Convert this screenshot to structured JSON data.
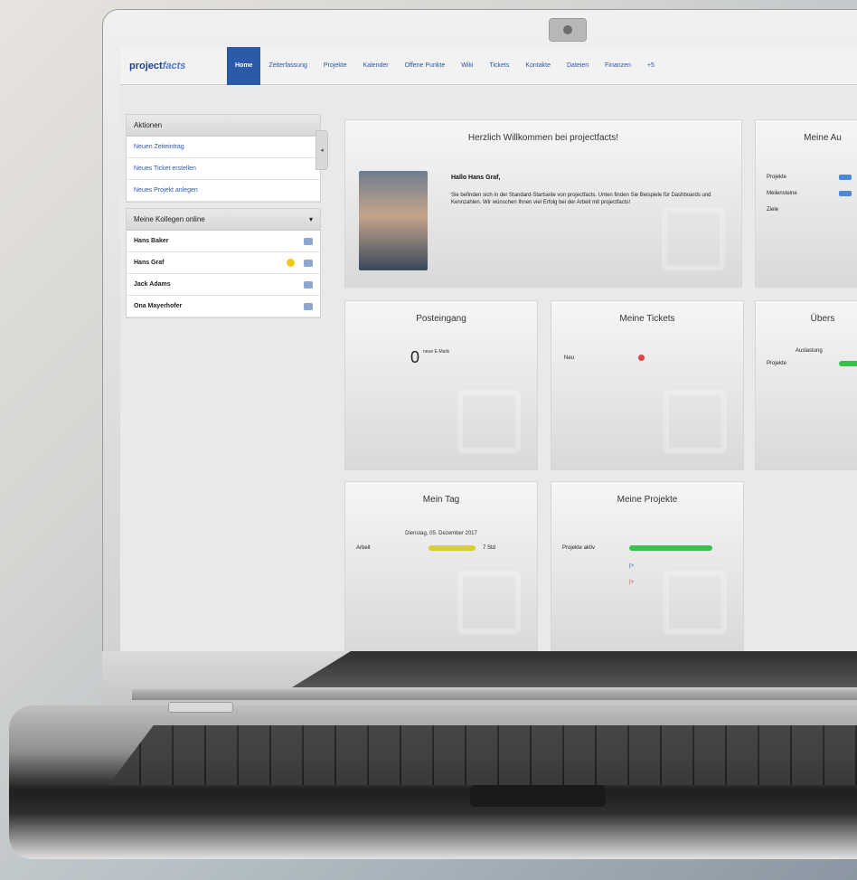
{
  "brand": {
    "part1": "project",
    "part2": "facts"
  },
  "nav": [
    {
      "label": "Home",
      "active": true
    },
    {
      "label": "Zeiterfassung",
      "active": false
    },
    {
      "label": "Projekte",
      "active": false
    },
    {
      "label": "Kalender",
      "active": false
    },
    {
      "label": "Offene Punkte",
      "active": false
    },
    {
      "label": "Wiki",
      "active": false
    },
    {
      "label": "Tickets",
      "active": false
    },
    {
      "label": "Kontakte",
      "active": false
    },
    {
      "label": "Dateien",
      "active": false
    },
    {
      "label": "Finanzen",
      "active": false
    },
    {
      "label": "+5",
      "active": false
    }
  ],
  "sidebar": {
    "actions_title": "Aktionen",
    "actions": [
      "Neuen Zeiteintrag",
      "Neues Ticket erstellen",
      "Neues Projekt anlegen"
    ],
    "colleagues_title": "Meine Kollegen online",
    "colleagues": [
      {
        "name": "Hans Baker"
      },
      {
        "name": "Hans Graf"
      },
      {
        "name": "Jack Adams"
      },
      {
        "name": "Ona Mayerhofer"
      }
    ]
  },
  "cards": {
    "welcome": {
      "title": "Herzlich Willkommen bei projectfacts!",
      "greeting": "Hallo Hans Graf,",
      "text": "Sie befinden sich in der Standard-Startseite von projectfacts. Unten finden Sie Beispiele für Dashboards und Kennzahlen. Wir wünschen Ihnen viel Erfolg bei der Arbeit mit projectfacts!"
    },
    "meine_au": {
      "title": "Meine Au",
      "rows": [
        {
          "label": "Projekte"
        },
        {
          "label": "Meilensteine"
        },
        {
          "label": "Ziele"
        }
      ]
    },
    "postein": {
      "title": "Posteingang",
      "count": "0",
      "caption": "neue E-Mails"
    },
    "tickets": {
      "title": "Meine Tickets",
      "row_label": "Neu"
    },
    "uebers": {
      "title": "Übers",
      "row_label": "Projekte",
      "subtitle": "Auslastung"
    },
    "tag": {
      "title": "Mein Tag",
      "date": "Dienstag, 05. Dezember 2017",
      "row_label": "Arbeit",
      "row_value": "7 Std",
      "progress": 0.65
    },
    "projekte": {
      "title": "Meine Projekte",
      "row_label": "Projekte aktiv",
      "progress": 0.92,
      "extra1": "|>",
      "extra2": "|>"
    }
  }
}
